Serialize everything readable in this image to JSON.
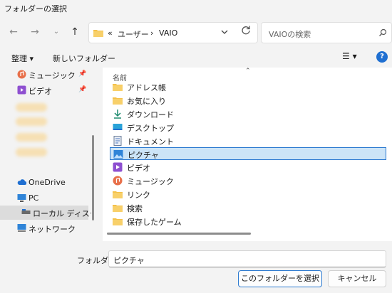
{
  "window": {
    "title": "フォルダーの選択"
  },
  "address": {
    "crumbs": [
      "«",
      "ユーザー",
      "›",
      "VAIO"
    ]
  },
  "search": {
    "placeholder": "VAIOの検索"
  },
  "toolbar": {
    "organize": "整理 ▾",
    "new_folder": "新しいフォルダー",
    "view": "☰ ▾",
    "help": "?"
  },
  "nav": {
    "items": [
      {
        "label": "ミュージック",
        "icon": "music-icon",
        "pinned": true
      },
      {
        "label": "ビデオ",
        "icon": "video-icon",
        "pinned": true
      },
      {
        "label": "OneDrive",
        "icon": "cloud-icon"
      },
      {
        "label": "PC",
        "icon": "computer-icon"
      },
      {
        "label": "ローカル ディスク (C",
        "icon": "drive-icon",
        "selected": true
      },
      {
        "label": "ネットワーク",
        "icon": "network-icon"
      }
    ]
  },
  "files": {
    "column": "名前",
    "items": [
      {
        "label": "アドレス帳",
        "icon": "folder-icon"
      },
      {
        "label": "お気に入り",
        "icon": "folder-icon"
      },
      {
        "label": "ダウンロード",
        "icon": "download-icon"
      },
      {
        "label": "デスクトップ",
        "icon": "desktop-icon"
      },
      {
        "label": "ドキュメント",
        "icon": "document-icon"
      },
      {
        "label": "ピクチャ",
        "icon": "pictures-icon",
        "selected": true
      },
      {
        "label": "ビデオ",
        "icon": "video-icon"
      },
      {
        "label": "ミュージック",
        "icon": "music-icon"
      },
      {
        "label": "リンク",
        "icon": "folder-icon"
      },
      {
        "label": "検索",
        "icon": "folder-icon"
      },
      {
        "label": "保存したゲーム",
        "icon": "folder-icon"
      }
    ]
  },
  "footer": {
    "folder_label": "フォルダー:",
    "folder_value": "ピクチャ",
    "select_button": "このフォルダーを選択",
    "cancel_button": "キャンセル"
  }
}
